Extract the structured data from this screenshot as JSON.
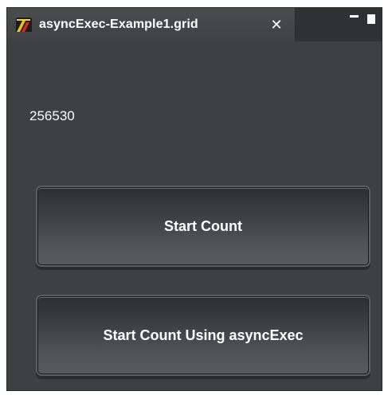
{
  "window": {
    "title": "asyncExec-Example1.grid",
    "close_glyph": "✕",
    "app_icon": "grid-app-icon"
  },
  "counter": {
    "value": "256530"
  },
  "buttons": {
    "start_count": "Start Count",
    "start_count_async": "Start Count Using asyncExec"
  },
  "colors": {
    "window_bg": "#3f4042",
    "titlebar_bg": "#303133",
    "text": "#ffffff"
  }
}
